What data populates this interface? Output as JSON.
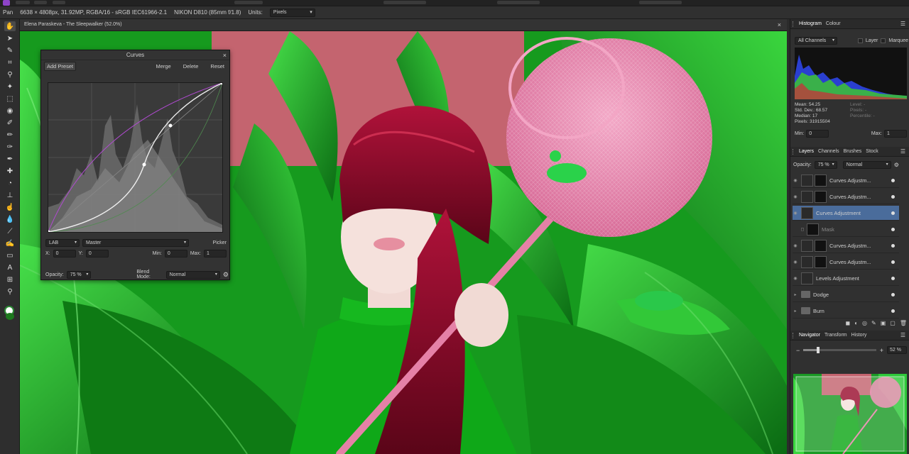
{
  "context_bar": {
    "tool_name": "Pan",
    "doc_info": "6638 × 4808px, 31.92MP, RGBA/16 - sRGB IEC61966-2.1",
    "camera": "NIKON D810 (85mm f/1.8)",
    "units_label": "Units:",
    "units_value": "Pixels"
  },
  "document": {
    "title": "Elena Paraskeva - The Sleepwalker (52.0%)",
    "close": "×"
  },
  "curves": {
    "title": "Curves",
    "close": "×",
    "add_preset": "Add Preset",
    "merge": "Merge",
    "delete": "Delete",
    "reset": "Reset",
    "colorspace": "LAB",
    "channel": "Master",
    "picker": "Picker",
    "x_label": "X:",
    "x_value": "0",
    "y_label": "Y:",
    "y_value": "0",
    "min_label": "Min:",
    "min_value": "0",
    "max_label": "Max:",
    "max_value": "1",
    "opacity_label": "Opacity:",
    "opacity_value": "75 %",
    "blend_label": "Blend Mode:",
    "blend_value": "Normal"
  },
  "histogram_panel": {
    "tabs": [
      "Histogram",
      "Colour"
    ],
    "channel": "All Channels",
    "layer_label": "Layer",
    "marquee_label": "Marquee",
    "stats": [
      "Mean: 54.25",
      "Std. Dev.: 68.57",
      "Median: 17",
      "Pixels: 31915504"
    ],
    "stats_right": [
      "Level: -",
      "Pixels: -",
      "Percentile: -"
    ],
    "min_label": "Min:",
    "min_value": "0",
    "max_label": "Max:",
    "max_value": "1"
  },
  "layers_panel": {
    "tabs": [
      "Layers",
      "Channels",
      "Brushes",
      "Stock"
    ],
    "opacity_label": "Opacity:",
    "opacity_value": "75 %",
    "blend_value": "Normal",
    "layers": [
      {
        "name": "Curves Adjustm..."
      },
      {
        "name": "Curves Adjustm..."
      },
      {
        "name": "Curves Adjustment"
      },
      {
        "name": "Mask"
      },
      {
        "name": "Curves Adjustm..."
      },
      {
        "name": "Curves Adjustm..."
      },
      {
        "name": "Levels Adjustment"
      },
      {
        "name": "Dodge"
      },
      {
        "name": "Burn"
      }
    ]
  },
  "navigator_panel": {
    "tabs": [
      "Navigator",
      "Transform",
      "History"
    ],
    "zoom_minus": "−",
    "zoom_plus": "+",
    "zoom_value": "52 %",
    "zoom_level": 0.2
  },
  "colors": {
    "accent_selected": "#4a6c9b",
    "affinity_purple": "#8e44c9",
    "leaf_green": "#1a9a25",
    "hair_red": "#8c0d2a",
    "net_pink": "#e07fa6"
  }
}
